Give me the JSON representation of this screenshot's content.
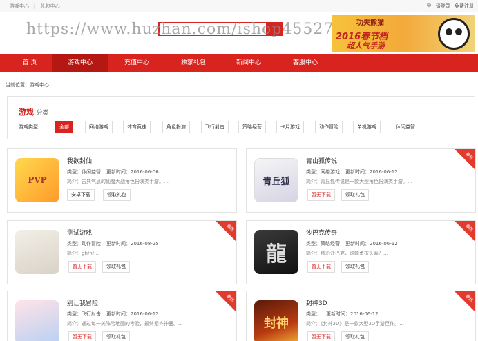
{
  "topbar": {
    "links": [
      "游戏中心",
      "礼包中心"
    ],
    "right": [
      "登",
      "请登录",
      "免费注册"
    ]
  },
  "header": {
    "watermark": "https://www.huzhan.com/ishop45527",
    "banner": {
      "title": "功夫熊猫",
      "line1": "2016春节档",
      "line2": "超人气手游"
    }
  },
  "nav": {
    "items": [
      "首 页",
      "游戏中心",
      "充值中心",
      "独家礼包",
      "新闻中心",
      "客服中心"
    ],
    "active_index": 1
  },
  "breadcrumb": "当前位置：游戏中心",
  "filter": {
    "title_highlight": "游戏",
    "title_rest": "分类",
    "type_label": "游戏类型",
    "chips": [
      "全部",
      "网络游戏",
      "体育竞速",
      "角色扮演",
      "飞行射击",
      "策略经营",
      "卡片游戏",
      "动作冒险",
      "单机游戏",
      "休闲益智"
    ],
    "selected_chip": "全部"
  },
  "badge_text": "最热",
  "games": [
    {
      "name": "我欲封仙",
      "type": "类型：休闲益智",
      "updated": "更新时间：2016-06-06",
      "desc": "简介：古典气息的仙魔大战角色扮演类手游。…",
      "download": "安卓下载",
      "gift": "领取礼包",
      "icon": "pvp-game-icon"
    },
    {
      "name": "青山狐传说",
      "type": "类型：网络游戏",
      "updated": "更新时间：2016-06-12",
      "desc": "简介：青丘狐传说是一款大型角色扮演类手游。…",
      "download": "暂无下载",
      "gift": "领取礼包",
      "icon": "qingqiu-fox-icon",
      "icon_text": "青丘狐"
    },
    {
      "name": "测试游戏",
      "type": "类型：动作冒险",
      "updated": "更新时间：2016-08-25",
      "desc": "简介：ghfhf…",
      "download": "暂无下载",
      "gift": "领取礼包",
      "icon": "anime-girl-icon"
    },
    {
      "name": "沙巴克传奇",
      "type": "类型：策略经营",
      "updated": "更新时间：2016-06-12",
      "desc": "简介：精彩沙巴克，谁能勇拔头筹？…",
      "download": "暂无下载",
      "gift": "领取礼包",
      "icon": "dragon-character-icon",
      "icon_text": "龍"
    },
    {
      "name": "别让我冒险",
      "type": "类型：飞行射击",
      "updated": "更新时间：2016-06-12",
      "desc": "简介：通过每一关阵险地图的考验，最终紧齐神器。…",
      "download": "暂无下载",
      "gift": "领取礼包",
      "icon": "anime-boy-icon"
    },
    {
      "name": "封神3D",
      "type": "类型：",
      "updated": "更新时间：2016-06-12",
      "desc": "简介：《封神3D》是一款大型3D手游巨作。…",
      "download": "暂无下载",
      "gift": "领取礼包",
      "icon": "fengshen-3d-icon",
      "icon_text": "封神"
    }
  ],
  "colors": {
    "accent": "#d8231f",
    "nav_active": "#b51713",
    "badge": "#e33a2e"
  }
}
